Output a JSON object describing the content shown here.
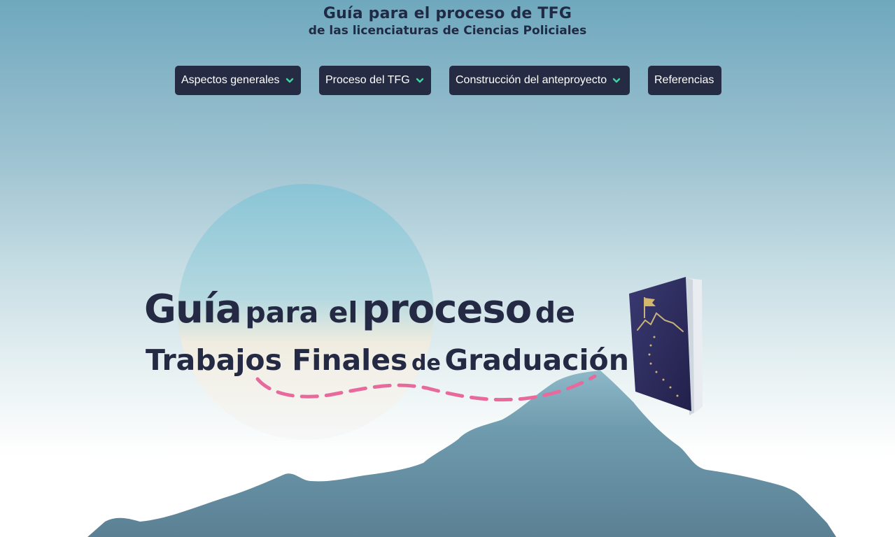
{
  "header": {
    "title": "Guía para el proceso de TFG",
    "subtitle": "de las licenciaturas de Ciencias Policiales"
  },
  "nav": {
    "items": [
      {
        "label": "Aspectos generales",
        "has_dropdown": true
      },
      {
        "label": "Proceso del TFG",
        "has_dropdown": true
      },
      {
        "label": "Construcción del anteproyecto",
        "has_dropdown": true
      },
      {
        "label": "Referencias",
        "has_dropdown": false
      }
    ]
  },
  "hero": {
    "line1": {
      "w1": "Guía",
      "w2": "para el",
      "w3": "proceso",
      "w4": "de"
    },
    "line2": {
      "w1": "Trabajos Finales",
      "w2": "de",
      "w3": "Graduación"
    }
  },
  "colors": {
    "nav_bg": "#262b44",
    "chevron": "#3ed6a0",
    "title_text": "#252a44",
    "path_dashes": "#e86a9c",
    "mountain": "#5e8a9d",
    "book": "#2a2850"
  }
}
